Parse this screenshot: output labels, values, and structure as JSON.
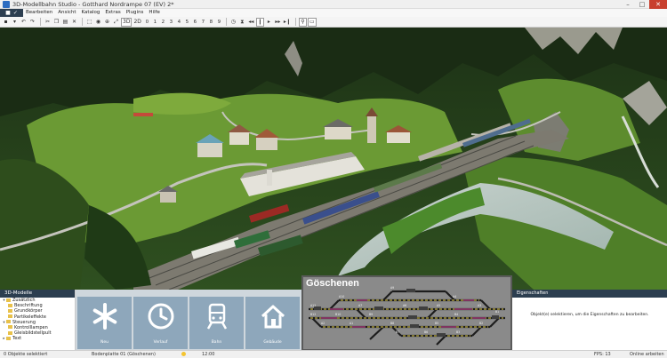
{
  "window": {
    "title": "3D-Modellbahn Studio - Gotthard Nordrampe 07 (EV) 2*",
    "minimize": "–",
    "maximize": "□",
    "close": "✕"
  },
  "menu": {
    "file_icons": [
      "■",
      "✓"
    ],
    "items": [
      "Bearbeiten",
      "Ansicht",
      "Katalog",
      "Extras",
      "Plugins",
      "Hilfe"
    ]
  },
  "toolbar": {
    "mode_3d": "3D",
    "mode_2d": "2D",
    "numbers": [
      "0",
      "1",
      "2",
      "3",
      "4",
      "5",
      "6",
      "7",
      "8",
      "9"
    ],
    "icons": [
      "save-icon",
      "dropdown-icon",
      "undo-icon",
      "redo-icon",
      "cut-icon",
      "copy-icon",
      "paste-icon",
      "delete-icon",
      "select-icon",
      "camera-icon",
      "zoom-icon",
      "fit-icon",
      "clock-icon",
      "hourglass-icon",
      "rewind-icon",
      "pause-icon",
      "play-icon",
      "fast-forward-icon",
      "skip-icon",
      "person-icon",
      "vr-icon"
    ]
  },
  "overlay": {
    "title": "Göschenen",
    "track_labels": [
      "A12",
      "A10",
      "A9",
      "A7",
      "A6",
      "A5",
      "A4",
      "A3",
      "A2",
      "A1",
      "B12",
      "B10",
      "B9",
      "B8",
      "B7",
      "B6",
      "B5",
      "B4",
      "B3",
      "B2",
      "B1"
    ]
  },
  "tree": {
    "header": "3D-Modelle",
    "items": [
      {
        "label": "Zusätzlich",
        "level": 1,
        "toggle": "▾"
      },
      {
        "label": "Beschriftung",
        "level": 2,
        "toggle": ""
      },
      {
        "label": "Grundkörper",
        "level": 2,
        "toggle": ""
      },
      {
        "label": "Partikeleffekte",
        "level": 2,
        "toggle": ""
      },
      {
        "label": "Steuerung",
        "level": 1,
        "toggle": "▾"
      },
      {
        "label": "Kontrolllampen",
        "level": 2,
        "toggle": ""
      },
      {
        "label": "Gleisbildstellpult",
        "level": 2,
        "toggle": ""
      },
      {
        "label": "Text",
        "level": 1,
        "toggle": "▸"
      }
    ]
  },
  "tiles": [
    {
      "label": "Neu",
      "icon": "asterisk-icon"
    },
    {
      "label": "Verlauf",
      "icon": "clock-icon"
    },
    {
      "label": "Bahn",
      "icon": "train-icon"
    },
    {
      "label": "Gebäude",
      "icon": "house-icon"
    }
  ],
  "properties": {
    "header": "Eigenschaften",
    "message": "Objekt(e) selektieren, um die Eigenschaften zu bearbeiten."
  },
  "statusbar": {
    "selection": "0 Objekte selektiert",
    "layer": "Bodenplatte 01 (Göschenen)",
    "time": "12:00",
    "fps": "FPS: 13",
    "online": "Online arbeiten"
  },
  "colors": {
    "dark_panel": "#2c3e50",
    "tile_blue": "#8ea7bb",
    "close_red": "#c8402f",
    "overlay_grey": "#8a8a8a"
  }
}
